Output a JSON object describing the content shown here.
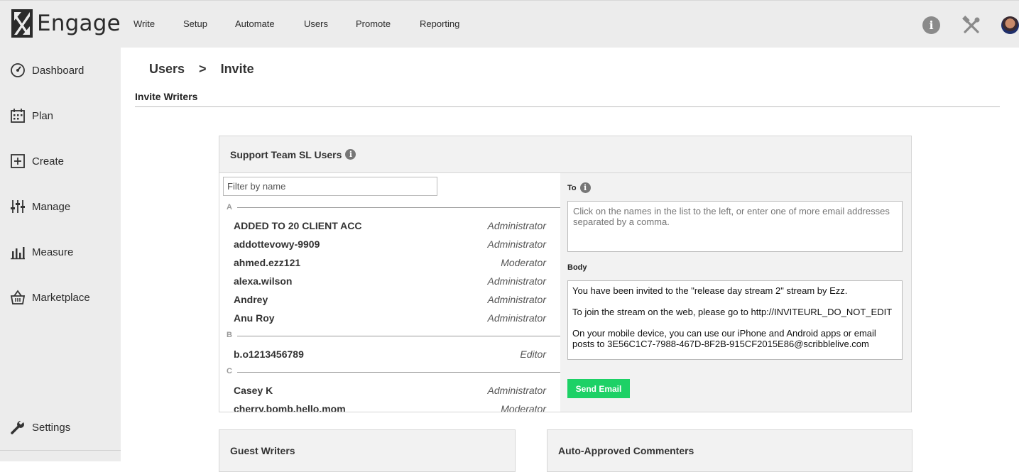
{
  "app": {
    "name": "Engage"
  },
  "topnav": [
    "Write",
    "Setup",
    "Automate",
    "Users",
    "Promote",
    "Reporting"
  ],
  "top_icons": [
    "info-icon",
    "tools-icon",
    "avatar"
  ],
  "sidebar": {
    "items": [
      {
        "label": "Dashboard",
        "icon": "dashboard-icon"
      },
      {
        "label": "Plan",
        "icon": "calendar-icon"
      },
      {
        "label": "Create",
        "icon": "plus-square-icon"
      },
      {
        "label": "Manage",
        "icon": "sliders-icon"
      },
      {
        "label": "Measure",
        "icon": "bar-chart-icon"
      },
      {
        "label": "Marketplace",
        "icon": "basket-icon"
      }
    ],
    "settings": {
      "label": "Settings",
      "icon": "wrench-icon"
    }
  },
  "breadcrumb": {
    "parent": "Users",
    "separator": ">",
    "current": "Invite"
  },
  "section_title": "Invite Writers",
  "panel": {
    "title": "Support Team SL Users",
    "filter_placeholder": "Filter by name",
    "groups": [
      {
        "letter": "A",
        "users": [
          {
            "name": "ADDED TO 20 CLIENT ACC",
            "role": "Administrator"
          },
          {
            "name": "addottevowy-9909",
            "role": "Administrator"
          },
          {
            "name": "ahmed.ezz121",
            "role": "Moderator"
          },
          {
            "name": "alexa.wilson",
            "role": "Administrator"
          },
          {
            "name": "Andrey",
            "role": "Administrator"
          },
          {
            "name": "Anu Roy",
            "role": "Administrator"
          }
        ]
      },
      {
        "letter": "B",
        "users": [
          {
            "name": "b.o1213456789",
            "role": "Editor"
          }
        ]
      },
      {
        "letter": "C",
        "users": [
          {
            "name": "Casey K",
            "role": "Administrator"
          },
          {
            "name": "cherry.bomb.hello.mom",
            "role": "Moderator"
          }
        ]
      }
    ],
    "to_label": "To",
    "to_placeholder": "Click on the names in the list to the left, or enter one of more email addresses separated by a comma.",
    "body_label": "Body",
    "body_lines": [
      "You have been invited to the \"release day stream 2\" stream by Ezz.",
      "To join the stream on the web, please go to http://INVITEURL_DO_NOT_EDIT",
      "On your mobile device, you can use our iPhone and Android apps or email posts to 3E56C1C7-7988-467D-8F2B-915CF2015E86@scribblelive.com"
    ],
    "send_label": "Send Email"
  },
  "lower_panels": {
    "guest": "Guest Writers",
    "commenters": "Auto-Approved Commenters"
  },
  "colors": {
    "send_button": "#1dd166",
    "sidebar_bg": "#ececec"
  }
}
